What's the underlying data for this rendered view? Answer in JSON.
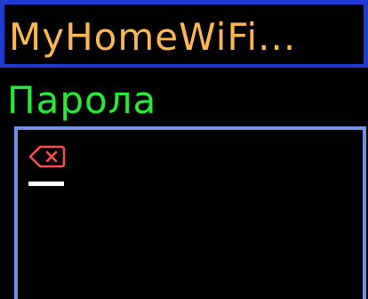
{
  "header": {
    "title": "MyHomeWiFi..."
  },
  "password": {
    "label": "Парола",
    "value": ""
  },
  "icons": {
    "backspace": "backspace-icon"
  },
  "colors": {
    "background": "#000000",
    "header_border": "#1f3bd6",
    "title_text": "#ffb84d",
    "label_text": "#22ee33",
    "input_border": "#6d92e6",
    "backspace": "#ff4d4d",
    "cursor": "#ffffff"
  }
}
